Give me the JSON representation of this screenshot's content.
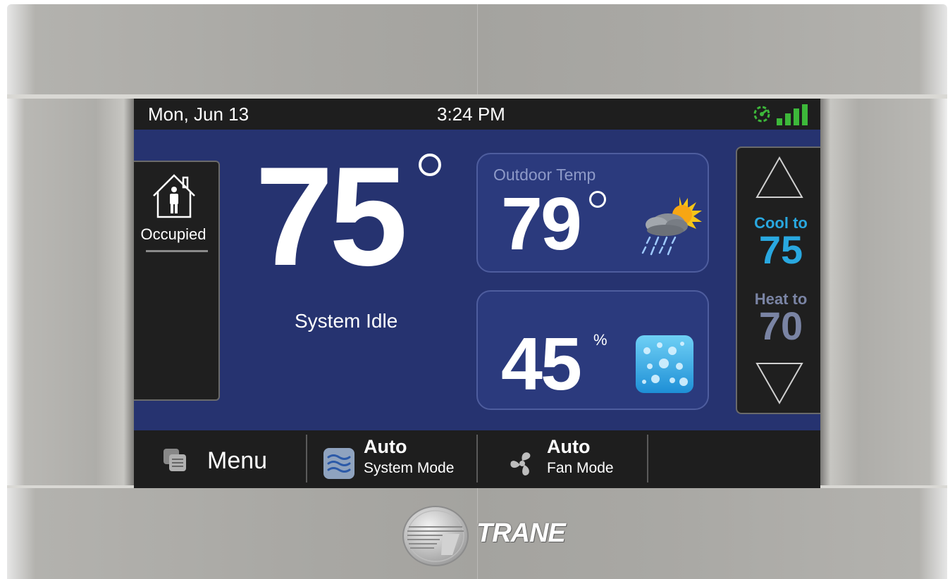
{
  "status": {
    "date": "Mon, Jun 13",
    "time": "3:24 PM",
    "network_icon": "network-connected-icon",
    "signal_icon": "signal-strength-icon",
    "signal_color": "#3db83a"
  },
  "occupancy": {
    "label": "Occupied",
    "icon": "house-person-icon"
  },
  "indoor": {
    "temperature": "75",
    "status": "System Idle"
  },
  "outdoor": {
    "label": "Outdoor Temp",
    "temperature": "79",
    "weather_icon": "rain-sun-cloud-icon"
  },
  "humidity": {
    "value": "45",
    "unit": "%",
    "icon": "water-drops-icon"
  },
  "setpoints": {
    "cool_label": "Cool to",
    "cool_value": "75",
    "heat_label": "Heat to",
    "heat_value": "70",
    "cool_color": "#29a8e0",
    "heat_color": "#7a84a4"
  },
  "bottom_bar": {
    "menu_label": "Menu",
    "system_mode": {
      "value": "Auto",
      "label": "System Mode"
    },
    "fan_mode": {
      "value": "Auto",
      "label": "Fan Mode"
    }
  },
  "brand": {
    "name": "TRANE"
  }
}
